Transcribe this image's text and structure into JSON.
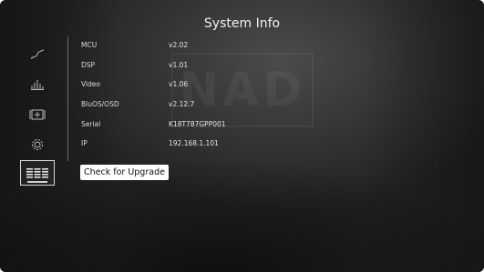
{
  "header": {
    "title": "System Info",
    "watermark": "NAD"
  },
  "sidebar": {
    "items": [
      {
        "icon": "waveform-icon",
        "active": false
      },
      {
        "icon": "equalizer-icon",
        "active": false
      },
      {
        "icon": "speaker-grid-icon",
        "active": false
      },
      {
        "icon": "settings-gear-icon",
        "active": false
      },
      {
        "icon": "system-info-icon",
        "active": true
      }
    ]
  },
  "info": {
    "rows": [
      {
        "label": "MCU",
        "value": "v2.02"
      },
      {
        "label": "DSP",
        "value": "v1.01"
      },
      {
        "label": "Video",
        "value": "v1.06"
      },
      {
        "label": "BluOS/OSD",
        "value": "v2.12.7"
      },
      {
        "label": "Serial",
        "value": "K18T787GPP001"
      },
      {
        "label": "IP",
        "value": "192.168.1.101"
      }
    ]
  },
  "actions": {
    "upgrade_label": "Check for Upgrade"
  },
  "colors": {
    "background": "#2c2c2c",
    "text": "#e8e8e8",
    "button_bg": "#ffffff",
    "button_text": "#111111"
  }
}
